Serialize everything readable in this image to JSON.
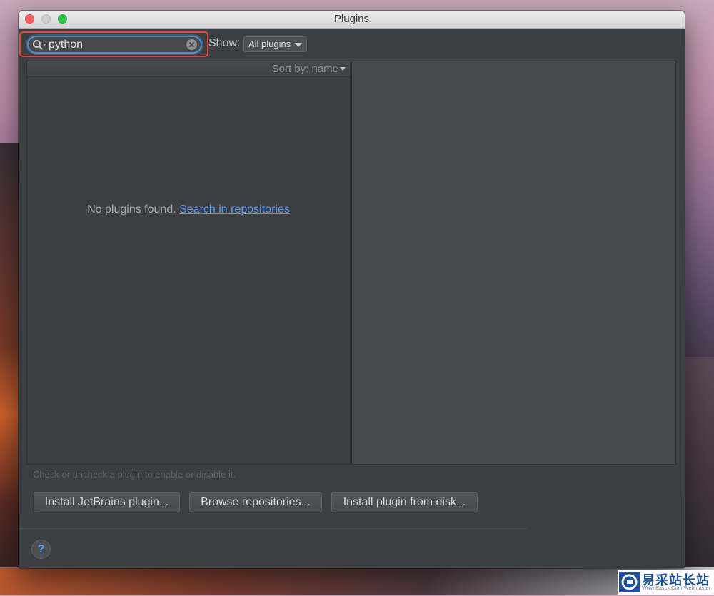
{
  "window": {
    "title": "Plugins"
  },
  "search": {
    "value": "python"
  },
  "filter": {
    "show_label": "Show:",
    "selected": "All plugins"
  },
  "list": {
    "sort_label": "Sort by: name",
    "empty_message": "No plugins found.",
    "search_link": "Search in repositories"
  },
  "hint": "Check or uncheck a plugin to enable or disable it.",
  "buttons": {
    "install_jetbrains": "Install JetBrains plugin...",
    "browse": "Browse repositories...",
    "install_disk": "Install plugin from disk..."
  },
  "help_label": "?",
  "watermark": {
    "text": "易采站长站",
    "sub": "Www.Easck.Com  Webmaster"
  },
  "colors": {
    "highlight": "#e9463a",
    "link": "#589df6",
    "focus": "#4d8fc9"
  }
}
